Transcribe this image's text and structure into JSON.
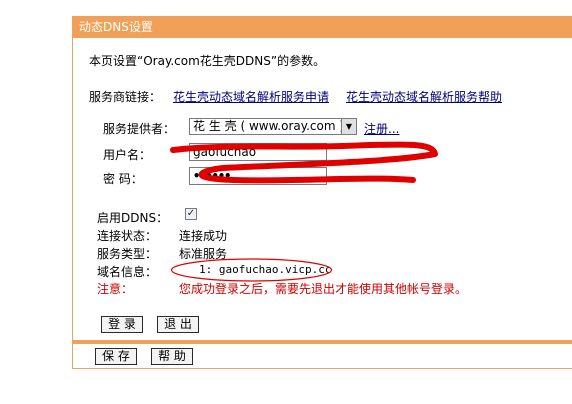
{
  "window": {
    "title": "动态DNS设置"
  },
  "page": {
    "description": "本页设置“Oray.com花生壳DDNS”的参数。"
  },
  "service_links": {
    "label": "服务商链接：",
    "apply_link": "花生壳动态域名解析服务申请",
    "help_link": "花生壳动态域名解析服务帮助"
  },
  "form": {
    "provider_label": "服务提供者：",
    "provider_selected": "花 生 壳 ( www.oray.com )",
    "register_link": "注册...",
    "username_label": "用户名：",
    "username_value": "gaofuchao",
    "password_label": "密  码：",
    "password_value": "••••••"
  },
  "status": {
    "enable_label": "启用DDNS：",
    "enable_checked": true,
    "connection_label": "连接状态：",
    "connection_value": "连接成功",
    "service_type_label": "服务类型：",
    "service_type_value": "标准服务",
    "domain_label": "域名信息：",
    "domain_value": "1: gaofuchao.vicp.cc",
    "note_label": "注意：",
    "note_value": "您成功登录之后，需要先退出才能使用其他帐号登录。"
  },
  "buttons": {
    "login": "登 录",
    "logout": "退 出",
    "save": "保 存",
    "help": "帮 助"
  },
  "colors": {
    "accent": "#f0a057",
    "link": "#00007a",
    "warning": "#cc0000",
    "annotation": "#e00000"
  }
}
